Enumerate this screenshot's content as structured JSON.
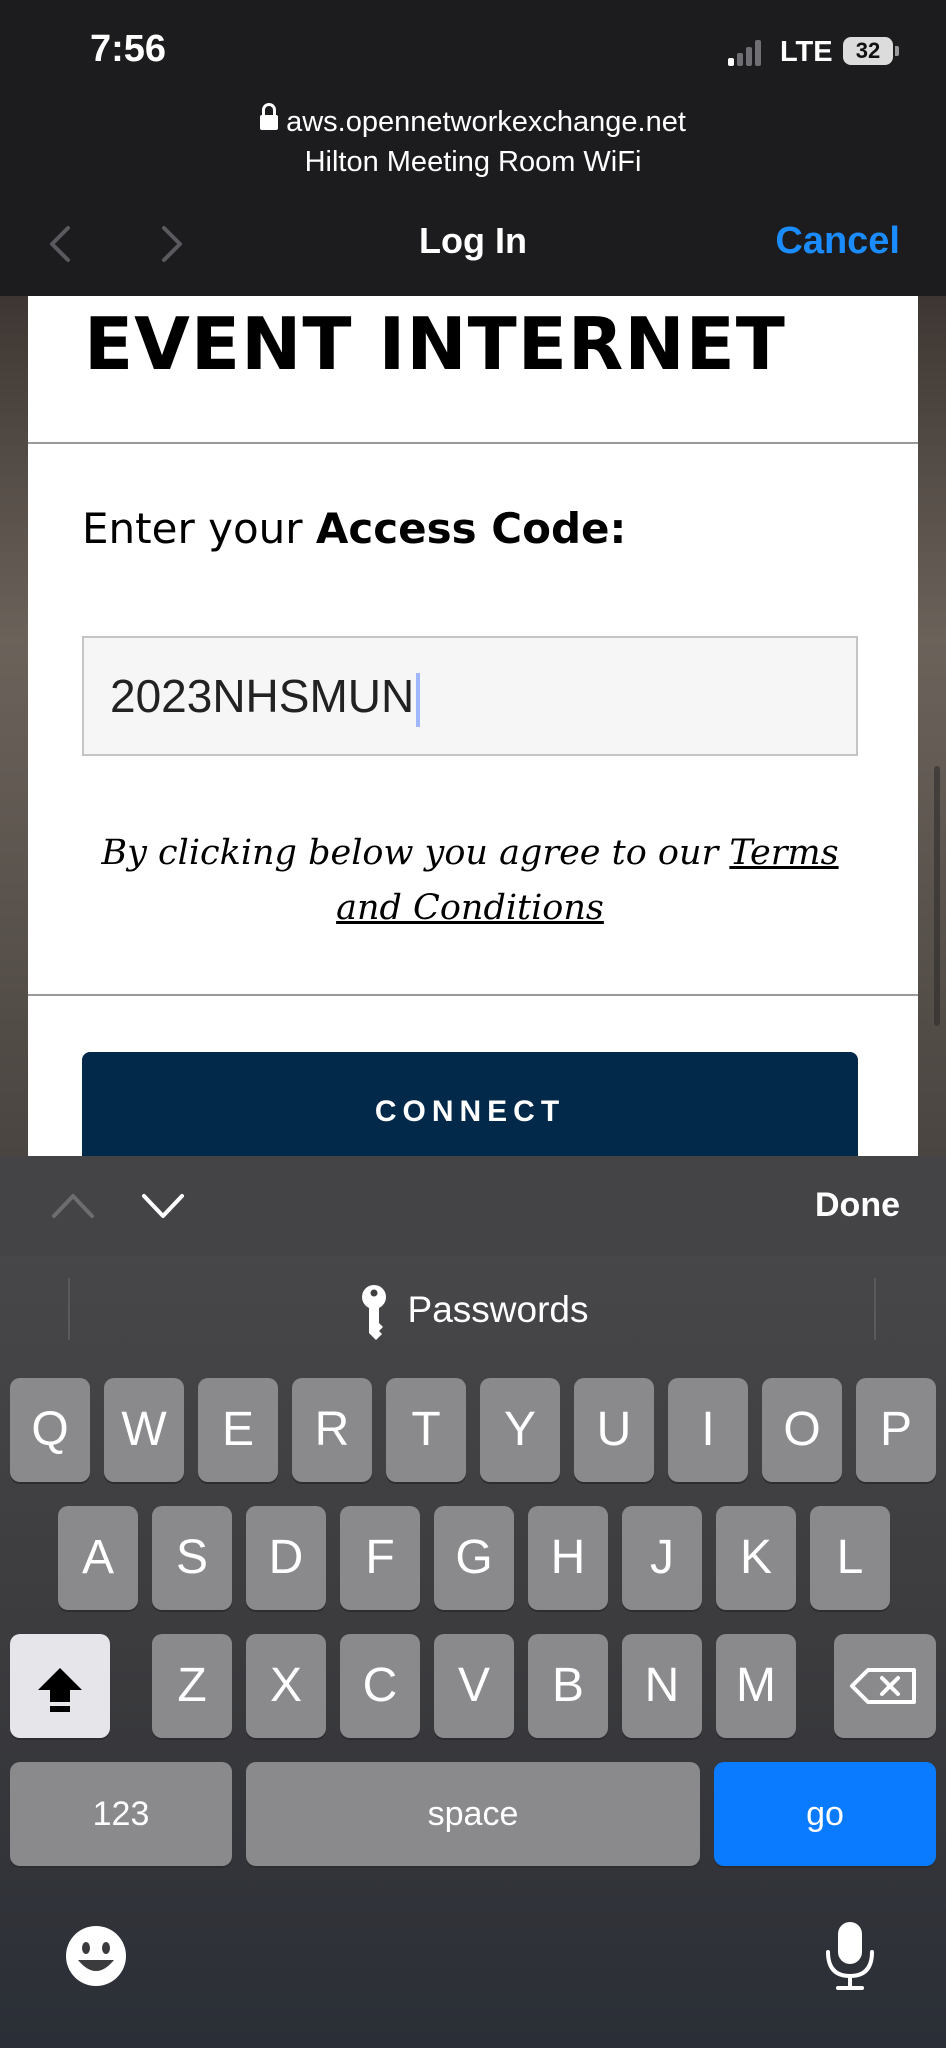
{
  "status_bar": {
    "time": "7:56",
    "network": "LTE",
    "battery": "32"
  },
  "browser": {
    "url": "aws.opennetworkexchange.net",
    "network_name": "Hilton Meeting Room WiFi",
    "title": "Log In",
    "cancel_label": "Cancel"
  },
  "page": {
    "title": "EVENT INTERNET",
    "prompt_prefix": "Enter your ",
    "prompt_bold": "Access Code:",
    "access_code_value": "2023NHSMUN",
    "terms_prefix": "By clicking below you agree to our ",
    "terms_link": "Terms and Conditions",
    "connect_label": "CONNECT"
  },
  "keyboard": {
    "done_label": "Done",
    "suggestion": "Passwords",
    "row1": [
      "Q",
      "W",
      "E",
      "R",
      "T",
      "Y",
      "U",
      "I",
      "O",
      "P"
    ],
    "row2": [
      "A",
      "S",
      "D",
      "F",
      "G",
      "H",
      "J",
      "K",
      "L"
    ],
    "row3": [
      "Z",
      "X",
      "C",
      "V",
      "B",
      "N",
      "M"
    ],
    "numbers_label": "123",
    "space_label": "space",
    "go_label": "go"
  },
  "colors": {
    "accent": "#1a8cff",
    "connect_bg": "#02284a",
    "go_key": "#0a7aff"
  }
}
